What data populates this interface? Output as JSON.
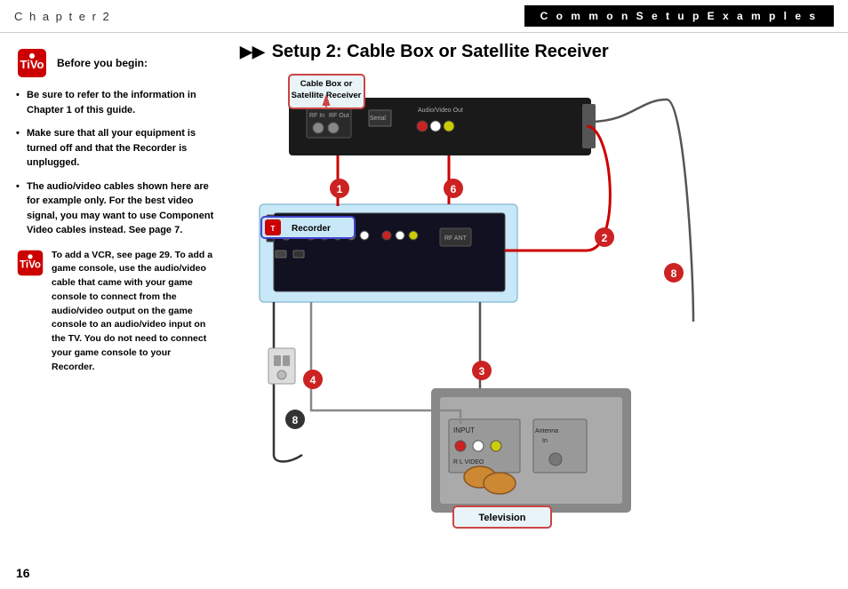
{
  "header": {
    "chapter": "C h a p t e r   2",
    "title": "C o m m o n   S e t u p   E x a m p l e s"
  },
  "setup": {
    "title": "Setup 2: Cable Box or Satellite Receiver",
    "arrows": "▶▶"
  },
  "left": {
    "before_begin": "Before you begin:",
    "bullets": [
      "Be sure to refer to the information in Chapter 1 of this guide.",
      "Make sure that all your equipment is turned off and that the Recorder is unplugged.",
      "The audio/video cables shown here are for example only. For the best video signal, you may want to use Component Video cables instead. See page 7."
    ],
    "note": "To add a VCR, see page 29. To add a game console, use the audio/video cable that came with your game console to connect from the audio/video output on the game console to an audio/video input on the TV. You do not need to connect your game console to your Recorder."
  },
  "diagram": {
    "cable_box_label": "Cable Box or\nSatellite Receiver",
    "recorder_label": "Recorder",
    "tv_label": "Television",
    "badges": [
      "1",
      "6",
      "2",
      "8",
      "4",
      "3",
      "8"
    ]
  },
  "page": {
    "number": "16"
  }
}
